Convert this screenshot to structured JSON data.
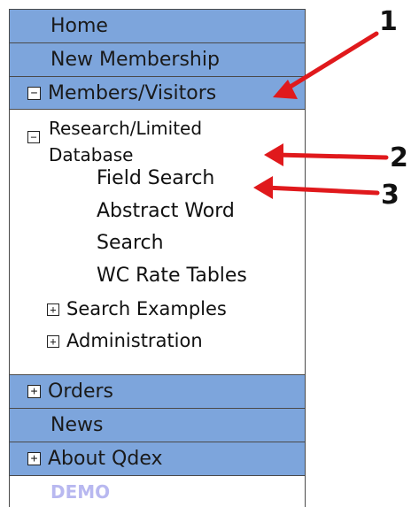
{
  "menu": {
    "home": "Home",
    "new_membership": "New Membership",
    "members_visitors": "Members/Visitors",
    "orders": "Orders",
    "news": "News",
    "about": "About Qdex",
    "demo": "DEMO"
  },
  "tree": {
    "research_line1": "Research/Limited",
    "research_line2": "Database",
    "field_search": "Field Search",
    "abstract_line1": "Abstract Word",
    "abstract_line2": "Search",
    "wc_rate_tables": "WC Rate Tables",
    "search_examples": "Search Examples",
    "administration": "Administration"
  },
  "icons": {
    "collapse": "−",
    "expand": "+"
  },
  "annotations": [
    "1",
    "2",
    "3"
  ],
  "colors": {
    "bar": "#7da5dc",
    "arrow": "#e0191c",
    "demo_text": "#b8b8f0"
  }
}
